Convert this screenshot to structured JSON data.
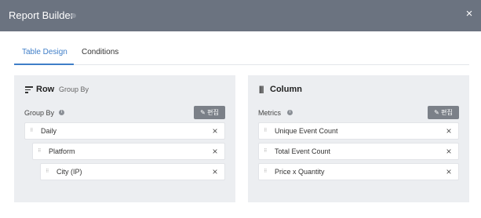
{
  "window": {
    "title": "Report Builder",
    "close_icon": "×"
  },
  "tabs": [
    {
      "label": "Table Design",
      "active": true
    },
    {
      "label": "Conditions",
      "active": false
    }
  ],
  "row_panel": {
    "title": "Row",
    "subtitle": "Group By",
    "section_label": "Group By",
    "edit_label": "편집",
    "items": [
      {
        "label": "Daily"
      },
      {
        "label": "Platform"
      },
      {
        "label": "City (IP)"
      }
    ]
  },
  "column_panel": {
    "title": "Column",
    "section_label": "Metrics",
    "edit_label": "편집",
    "items": [
      {
        "label": "Unique Event Count"
      },
      {
        "label": "Total Event Count"
      },
      {
        "label": "Price x Quantity"
      }
    ]
  },
  "colors": {
    "header_bg": "#6b7380",
    "accent": "#3f7ec8",
    "panel_bg": "#eceef1",
    "button_bg": "#7b8088"
  },
  "icons": {
    "close": "close-icon",
    "row": "sort-lines-icon",
    "column": "columns-icon",
    "info": "info-icon",
    "edit": "pencil-icon",
    "drag": "drag-handle-icon",
    "remove": "remove-x-icon"
  }
}
